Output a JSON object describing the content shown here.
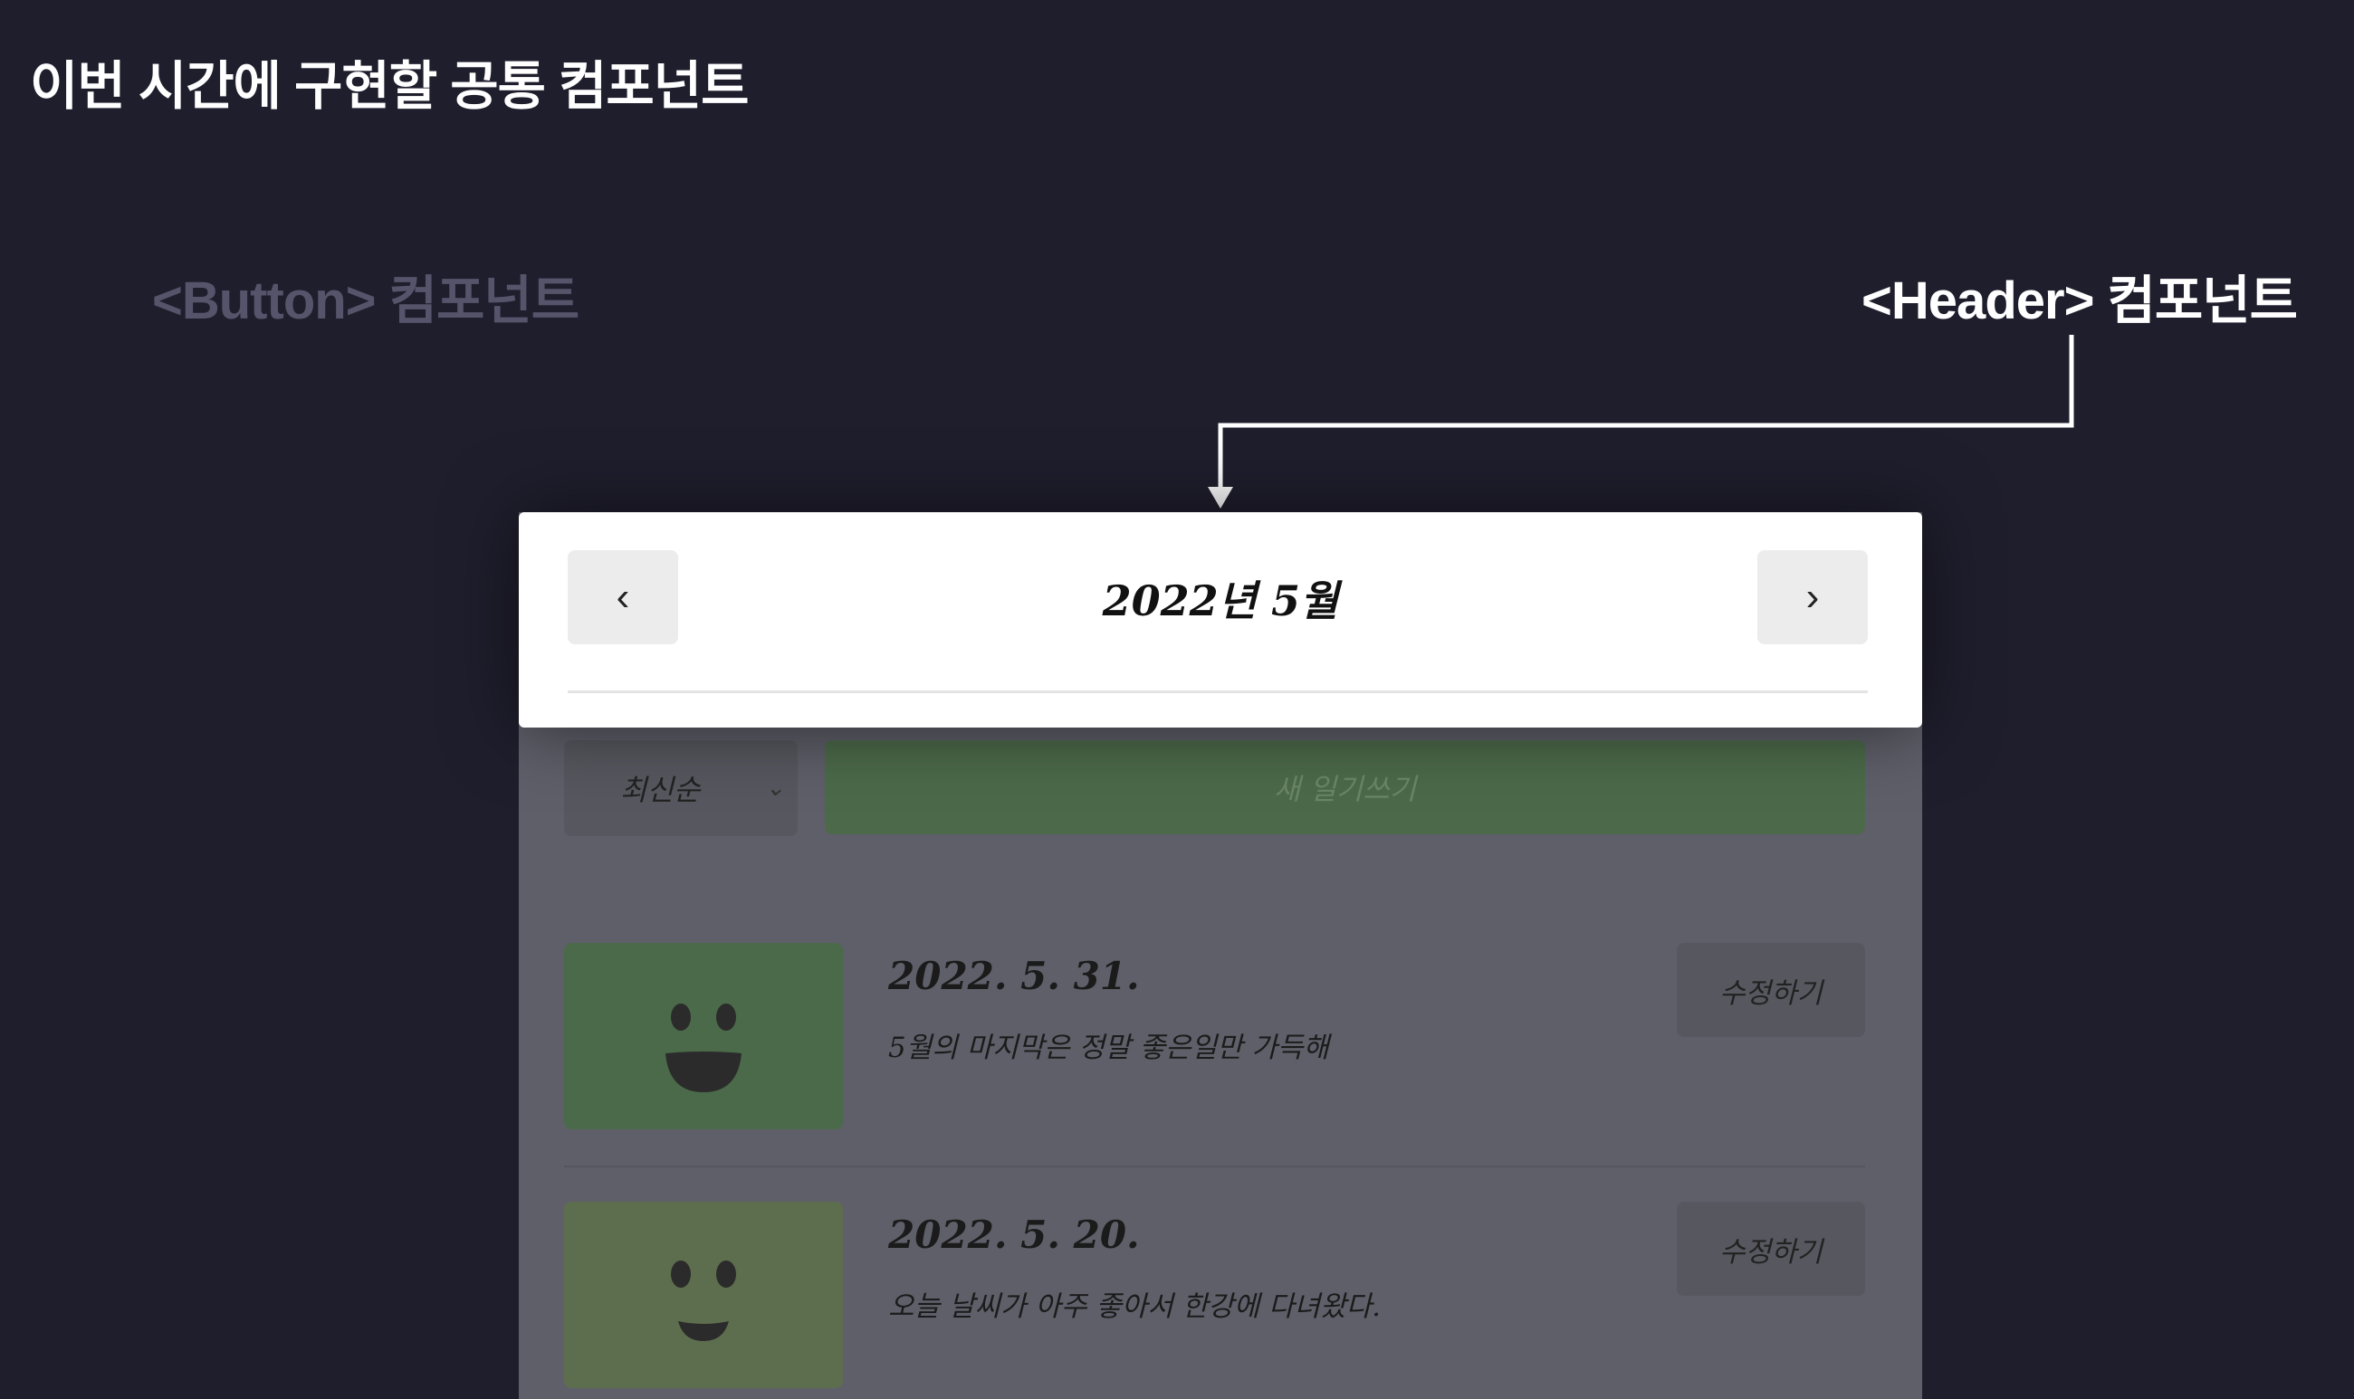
{
  "slide": {
    "title": "이번 시간에 구현할 공통 컴포넌트",
    "button_label": "<Button> 컴포넌트",
    "header_label": "<Header> 컴포넌트"
  },
  "header": {
    "title": "2022년 5월",
    "prev_icon": "‹",
    "next_icon": "›"
  },
  "toolbar": {
    "sort_value": "최신순",
    "new_label": "새 일기쓰기"
  },
  "diaries": [
    {
      "date": "2022. 5. 31.",
      "content": "5월의 마지막은 정말 좋은일만 가득해",
      "edit_label": "수정하기",
      "emotion": "happy"
    },
    {
      "date": "2022. 5. 20.",
      "content": "오늘 날씨가 아주 좋아서 한강에 다녀왔다.",
      "edit_label": "수정하기",
      "emotion": "smile"
    }
  ],
  "colors": {
    "background": "#1f1e2d",
    "accent_green": "#4c6a4a",
    "overlay": "#5f5f6a"
  }
}
